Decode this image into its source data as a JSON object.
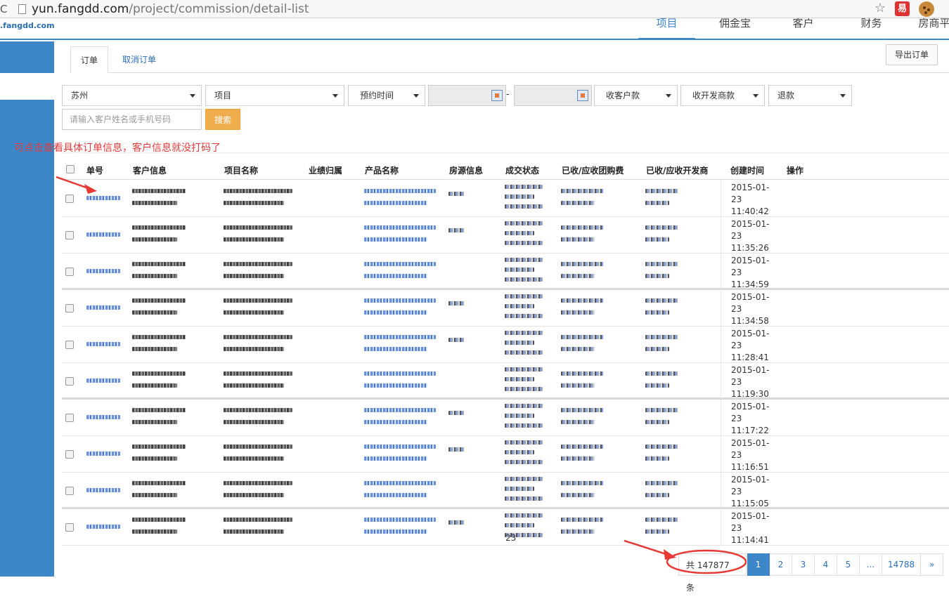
{
  "browser": {
    "url_host": "yun.fangdd.com",
    "url_path": "/project/commission/detail-list",
    "ext1_label": "易"
  },
  "site": {
    "logo": ".fangdd.com",
    "nav": [
      "项目",
      "佣金宝",
      "客户",
      "财务",
      "房商平台"
    ]
  },
  "tabs": {
    "orders": "订单",
    "cancelled": "取消订单"
  },
  "export_button": "导出订单",
  "filters": {
    "city": "苏州",
    "project": "项目",
    "booking_time": "预约时间",
    "receivable_customer": "收客户款",
    "receivable_developer": "收开发商款",
    "refund": "退款",
    "search_placeholder": "请输入客户姓名或手机号码",
    "search_button": "搜索",
    "date_separator": "-"
  },
  "annotation": "可点击查看具体订单信息，客户信息就没打码了",
  "table": {
    "headers": [
      "单号",
      "客户信息",
      "项目名称",
      "业绩归属",
      "产品名称",
      "房源信息",
      "成交状态",
      "已收/应收团购费",
      "已收/应收开发商",
      "创建时间",
      "操作"
    ],
    "rows": [
      {
        "time": "2015-01-\n23\n11:40:42"
      },
      {
        "time": "2015-01-\n23\n11:35:26"
      },
      {
        "time": "2015-01-\n23\n11:34:59"
      },
      {
        "time": "2015-01-\n23\n11:34:58"
      },
      {
        "time": "2015-01-\n23\n11:28:41"
      },
      {
        "time": "2015-01-\n23\n11:19:30"
      },
      {
        "time": "2015-01-\n23\n11:17:22"
      },
      {
        "time": "2015-01-\n23\n11:16:51"
      },
      {
        "time": "2015-01-\n23\n11:15:05"
      },
      {
        "time": "2015-01-\n23\n11:14:41"
      }
    ],
    "last_row_status_suffix": "23"
  },
  "pagination": {
    "total": "共 147877 条",
    "pages": [
      "1",
      "2",
      "3",
      "4",
      "5",
      "...",
      "14788",
      "»"
    ],
    "current": "1"
  },
  "colors": {
    "accent": "#3d87c9",
    "search_button": "#f0ad4e",
    "annotation": "#e03a3a"
  }
}
